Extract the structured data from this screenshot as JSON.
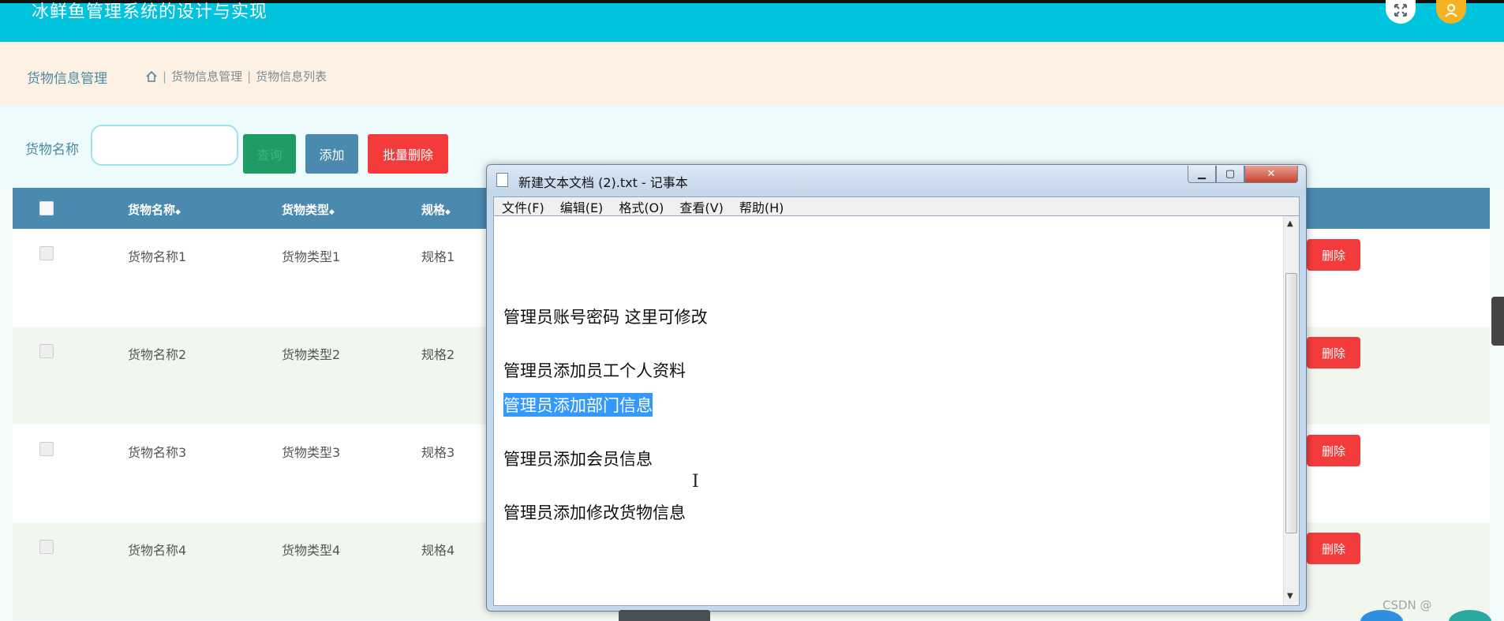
{
  "app": {
    "title": "冰鲜鱼管理系统的设计与实现"
  },
  "header": {
    "fullscreen_icon": "expand-icon",
    "avatar_icon": "user-icon"
  },
  "breadcrumb": {
    "page_title": "货物信息管理",
    "home_icon": "home-icon",
    "separator": "|",
    "items": [
      "货物信息管理",
      "货物信息列表"
    ]
  },
  "search": {
    "label": "货物名称",
    "input_value": "",
    "search_button": "查询",
    "add_button": "添加",
    "batch_delete_button": "批量删除"
  },
  "table": {
    "columns": [
      "货物名称",
      "货物类型",
      "规格"
    ],
    "sort_glyph": "◆",
    "rows": [
      {
        "name": "货物名称1",
        "type": "货物类型1",
        "spec": "规格1",
        "delete": "删除"
      },
      {
        "name": "货物名称2",
        "type": "货物类型2",
        "spec": "规格2",
        "delete": "删除"
      },
      {
        "name": "货物名称3",
        "type": "货物类型3",
        "spec": "规格3",
        "delete": "删除"
      },
      {
        "name": "货物名称4",
        "type": "货物类型4",
        "spec": "规格4",
        "delete": "删除"
      }
    ]
  },
  "notepad": {
    "title": "新建文本文档 (2).txt - 记事本",
    "controls": {
      "minimize": "▁",
      "maximize": "▢",
      "close": "✕"
    },
    "menu": [
      "文件(F)",
      "编辑(E)",
      "格式(O)",
      "查看(V)",
      "帮助(H)"
    ],
    "lines": [
      "管理员账号密码  这里可修改",
      "管理员添加员工个人资料",
      "管理员添加部门信息",
      "管理员添加会员信息",
      "管理员添加修改货物信息"
    ],
    "selected_line": "管理员添加部门信息"
  },
  "watermark": "CSDN @",
  "colors": {
    "topbar": "#00c4dd",
    "table_header": "#4a8aae",
    "danger": "#f33b3b",
    "success": "#1e9c63",
    "breadcrumb_bg": "#fdf1e4"
  }
}
